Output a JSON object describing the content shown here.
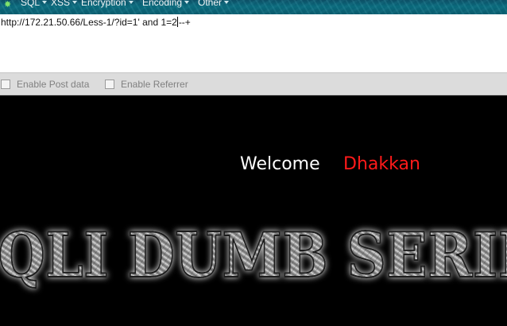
{
  "toolbar": {
    "icon": "green-sparkle-icon",
    "menus": [
      {
        "label": "SQL"
      },
      {
        "label": "XSS"
      },
      {
        "label": "Encryption"
      },
      {
        "label": "Encoding"
      },
      {
        "label": "Other"
      }
    ]
  },
  "url_box": {
    "before_caret": "http://172.21.50.66/Less-1/?id=1' and 1=2",
    "after_caret": "--+"
  },
  "options": {
    "post_label": "Enable Post data",
    "post_checked": false,
    "referrer_label": "Enable Referrer",
    "referrer_checked": false
  },
  "page": {
    "welcome_label": "Welcome",
    "user_name": "Dhakkan",
    "banner_text": "SQLI DUMB SERIES",
    "colors": {
      "background": "#000000",
      "welcome": "#ffffff",
      "name": "#ff1a1a"
    }
  }
}
